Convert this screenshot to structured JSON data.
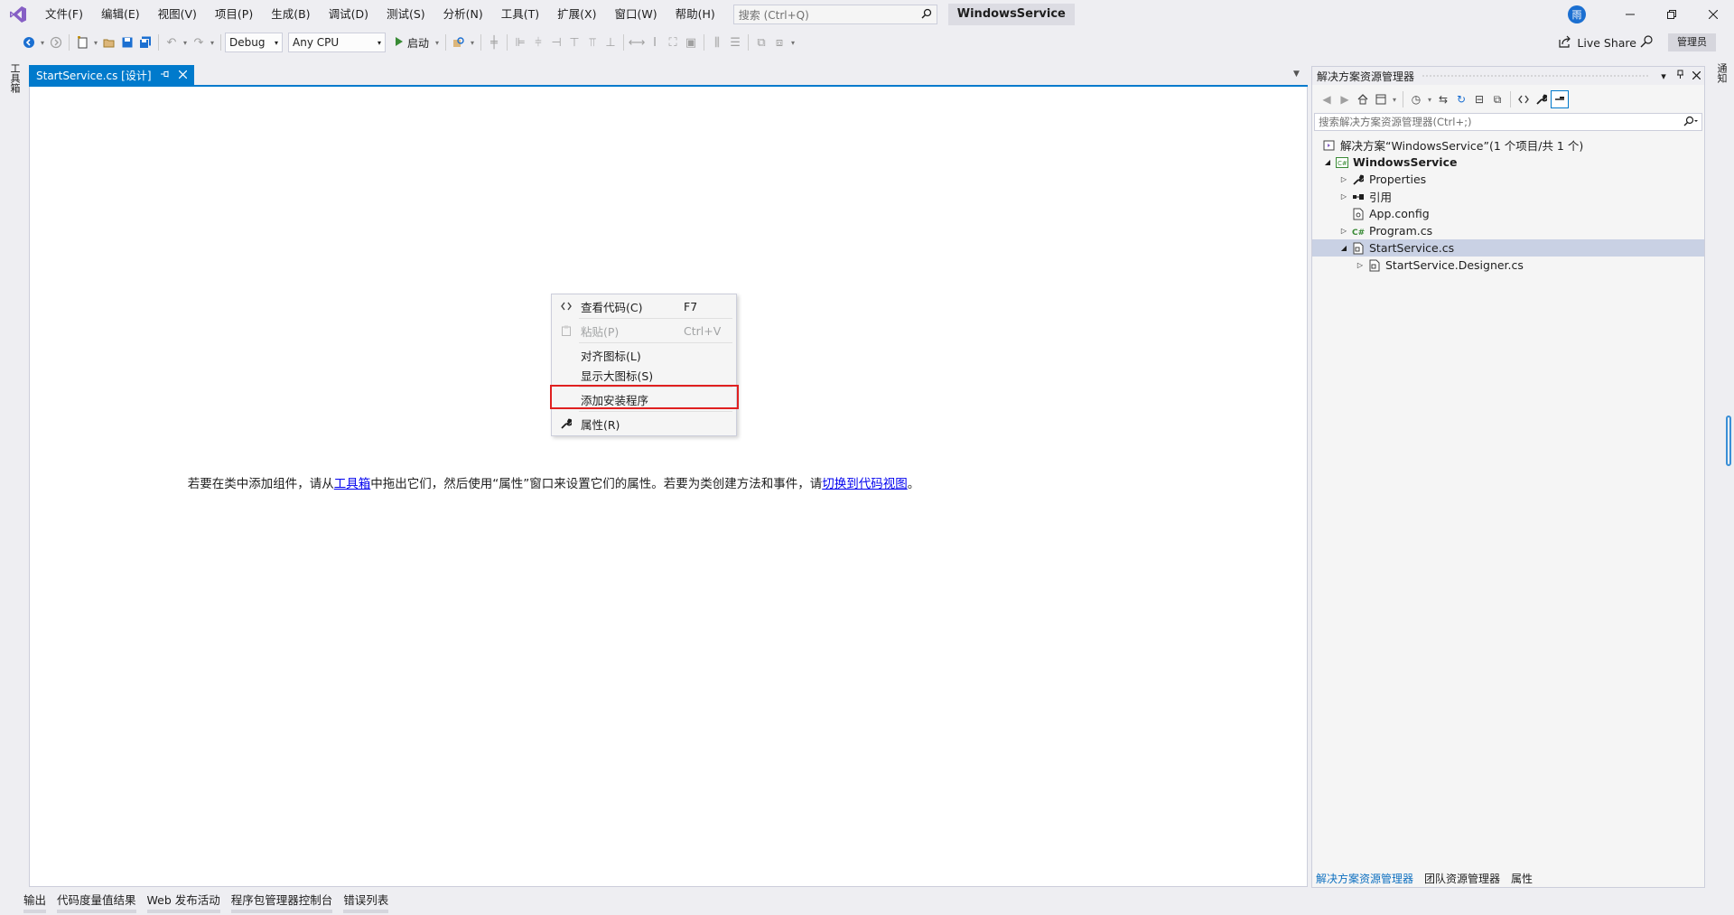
{
  "menu": [
    "文件(F)",
    "编辑(E)",
    "视图(V)",
    "项目(P)",
    "生成(B)",
    "调试(D)",
    "测试(S)",
    "分析(N)",
    "工具(T)",
    "扩展(X)",
    "窗口(W)",
    "帮助(H)"
  ],
  "search": {
    "placeholder": "搜索 (Ctrl+Q)"
  },
  "solution_name": "WindowsService",
  "user_initial": "雨",
  "toolbar": {
    "config": "Debug",
    "platform": "Any CPU",
    "start_label": "启动",
    "liveshare_label": "Live Share",
    "admin_label": "管理员"
  },
  "left_strip": {
    "toolbox_label": "工具箱"
  },
  "right_strip": {
    "notifications_label": "通知"
  },
  "doc_tab": {
    "label": "StartService.cs [设计]"
  },
  "designer": {
    "hint_part1": "若要在类中添加组件，请从",
    "hint_link1": "工具箱",
    "hint_part2": "中拖出它们，然后使用“属性”窗口来设置它们的属性。若要为类创建方法和事件，请",
    "hint_link2": "切换到代码视图",
    "hint_part3": "。"
  },
  "context_menu": {
    "view_code": {
      "label": "查看代码(C)",
      "shortcut": "F7"
    },
    "paste": {
      "label": "粘贴(P)",
      "shortcut": "Ctrl+V"
    },
    "align_icons": {
      "label": "对齐图标(L)"
    },
    "large_icons": {
      "label": "显示大图标(S)"
    },
    "add_installer": {
      "label": "添加安装程序"
    },
    "properties": {
      "label": "属性(R)"
    }
  },
  "solution_explorer": {
    "title": "解决方案资源管理器",
    "search_placeholder": "搜索解决方案资源管理器(Ctrl+;)",
    "tree": {
      "solution": "解决方案“WindowsService”(1 个项目/共 1 个)",
      "project": "WindowsService",
      "properties": "Properties",
      "references": "引用",
      "app_config": "App.config",
      "program": "Program.cs",
      "start_service": "StartService.cs",
      "designer": "StartService.Designer.cs"
    },
    "bottom_tabs": [
      "解决方案资源管理器",
      "团队资源管理器",
      "属性"
    ]
  },
  "bottom_tabs": [
    "输出",
    "代码度量值结果",
    "Web 发布活动",
    "程序包管理器控制台",
    "错误列表"
  ],
  "colors": {
    "accent": "#007acc",
    "highlight_box": "#e02020",
    "link": "#0000ee",
    "vs_purple": "#865fc5"
  }
}
